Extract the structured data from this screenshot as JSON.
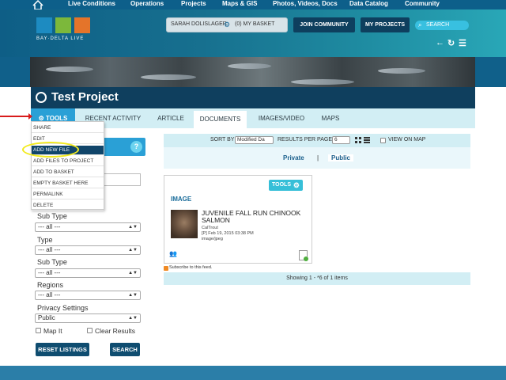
{
  "topnav": {
    "items": [
      "Live Conditions",
      "Operations",
      "Projects",
      "Maps & GIS",
      "Photos, Videos, Docs",
      "Data Catalog",
      "Community"
    ]
  },
  "logo": {
    "text": "BAY·DELTA LIVE"
  },
  "header": {
    "username": "SARAH DOLISLAGER",
    "basket": "(0) MY BASKET",
    "join": "JOIN COMMUNITY",
    "my_projects": "MY PROJECTS",
    "search": "SEARCH"
  },
  "title": "Test Project",
  "tabs": [
    "TOOLS",
    "RECENT ACTIVITY",
    "ARTICLE",
    "DOCUMENTS",
    "IMAGES/VIDEO",
    "MAPS"
  ],
  "tools_menu": [
    "SHARE",
    "EDIT",
    "ADD NEW FILE",
    "ADD FILES TO PROJECT",
    "ADD TO BASKET",
    "EMPTY BASKET HERE",
    "PERMALINK",
    "DELETE"
  ],
  "sidebar": {
    "help": "?",
    "filters": [
      {
        "label": "Sub Type",
        "value": "--- all ---"
      },
      {
        "label": "Type",
        "value": "--- all ---"
      },
      {
        "label": "Sub Type",
        "value": "--- all ---"
      },
      {
        "label": "Regions",
        "value": "--- all ---"
      },
      {
        "label": "Privacy Settings",
        "value": "Public"
      }
    ],
    "map_it": "Map It",
    "clear_results": "Clear Results",
    "reset": "RESET LISTINGS",
    "search": "SEARCH"
  },
  "toolbar": {
    "sort_by": "SORT BY",
    "sort_value": "Modified Da",
    "results_per_page": "RESULTS PER PAGE",
    "per_page_value": "6",
    "view_on_map": "VIEW ON MAP"
  },
  "privacy": {
    "private": "Private",
    "separator": "|",
    "public": "Public"
  },
  "card": {
    "tools": "TOOLS",
    "type": "IMAGE",
    "title": "JUVENILE FALL RUN CHINOOK SALMON",
    "org": "CalTrout",
    "date": "[P] Feb 19, 2015 03:38 PM",
    "mime": "image/jpeg"
  },
  "subscribe": "Subscribe to this feed.",
  "showing": "Showing 1 - *6 of 1 items",
  "colors": {
    "nav": "#0d5f8a",
    "title_bar": "#0f3f5e",
    "accent": "#2aa0d6",
    "light": "#d2eef4",
    "highlight": "#f2ea1d",
    "arrow": "#d81b1b"
  }
}
